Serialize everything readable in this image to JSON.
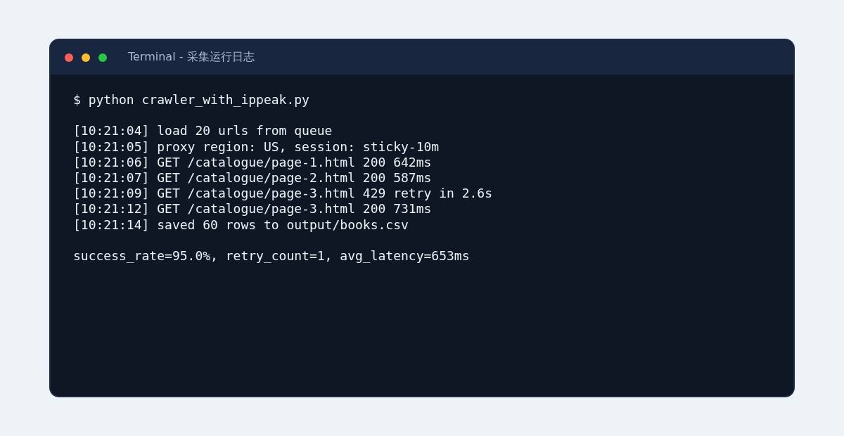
{
  "window": {
    "title": "Terminal - 采集运行日志",
    "buttons": [
      {
        "color": "#ff5f57"
      },
      {
        "color": "#febc2e"
      },
      {
        "color": "#28c840"
      }
    ]
  },
  "command": "$ python crawler_with_ippeak.py",
  "log": [
    "[10:21:04] load 20 urls from queue",
    "[10:21:05] proxy region: US, session: sticky-10m",
    "[10:21:06] GET /catalogue/page-1.html 200 642ms",
    "[10:21:07] GET /catalogue/page-2.html 200 587ms",
    "[10:21:09] GET /catalogue/page-3.html 429 retry in 2.6s",
    "[10:21:12] GET /catalogue/page-3.html 200 731ms",
    "[10:21:14] saved 60 rows to output/books.csv"
  ],
  "summary": "success_rate=95.0%, retry_count=1, avg_latency=653ms"
}
